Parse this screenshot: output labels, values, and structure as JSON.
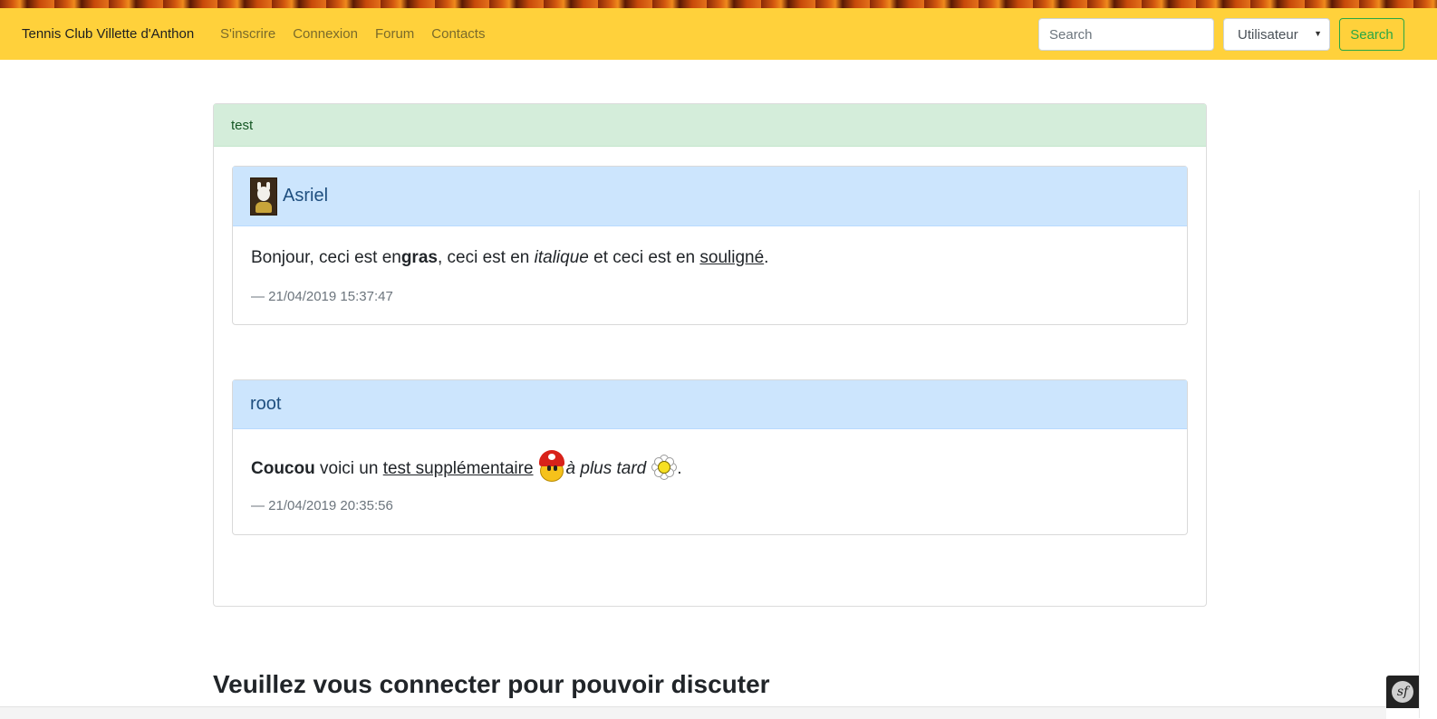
{
  "navbar": {
    "brand": "Tennis Club Villette d'Anthon",
    "links": [
      "S'inscrire",
      "Connexion",
      "Forum",
      "Contacts"
    ],
    "search_placeholder": "Search",
    "select_value": "Utilisateur",
    "search_button": "Search"
  },
  "topic": {
    "title": "test"
  },
  "posts": [
    {
      "author": "Asriel",
      "text": {
        "part1": "Bonjour, ceci est en",
        "bold": "gras",
        "part2": ", ceci est en ",
        "italic": "italique",
        "part3": " et ceci est en ",
        "underline": "souligné",
        "part4": "."
      },
      "date": "— 21/04/2019 15:37:47"
    },
    {
      "author": "root",
      "text": {
        "bold": "Coucou",
        "part1": " voici un ",
        "underline": "test supplémentaire",
        "italic": "à plus tard",
        "part2": "."
      },
      "date": "— 21/04/2019 20:35:56"
    }
  ],
  "main": {
    "login_prompt": "Veuillez vous connecter pour pouvoir discuter"
  },
  "icons": {
    "avatar": "asriel-avatar",
    "emoji1": "mario-smiley-icon",
    "emoji2": "daisy-smiley-icon",
    "debug": "symfony-icon"
  },
  "colors": {
    "navbar": "#ffd13b",
    "topic_header": "#d4edda",
    "post_header": "#cce5fd",
    "search_button": "#28a745"
  },
  "debug_badge": "sf"
}
